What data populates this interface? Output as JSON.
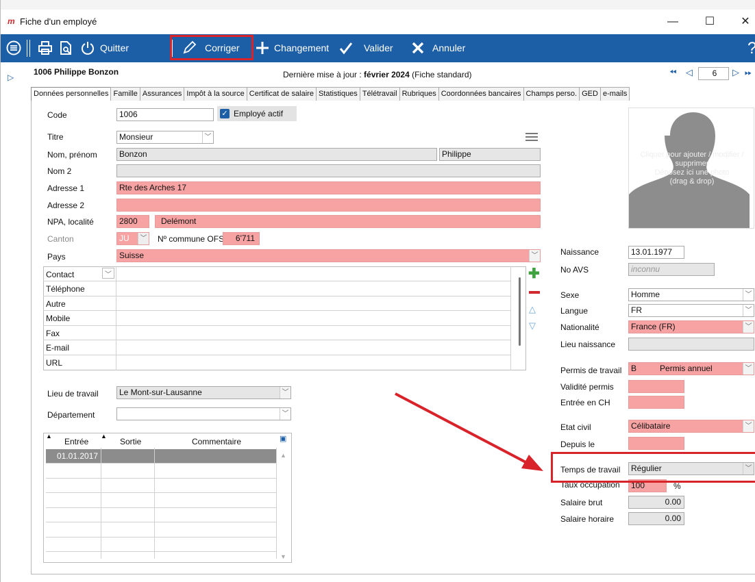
{
  "window": {
    "app_logo": "m",
    "title": "Fiche d'un employé",
    "min": "—",
    "max": "☐",
    "close": "✕"
  },
  "toolbar": {
    "quit": "Quitter",
    "correct": "Corriger",
    "change": "Changement",
    "validate": "Valider",
    "cancel": "Annuler"
  },
  "header": {
    "employee": "1006 Philippe Bonzon",
    "update_prefix": "Dernière mise à jour : ",
    "update_date": "février 2024",
    "update_suffix": " (Fiche standard)",
    "record_no": "6"
  },
  "tabs": [
    "Données personnelles",
    "Famille",
    "Assurances",
    "Impôt à la source",
    "Certificat de salaire",
    "Statistiques",
    "Télétravail",
    "Rubriques",
    "Coordonnées bancaires",
    "Champs perso.",
    "GED",
    "e-mails"
  ],
  "form": {
    "code_label": "Code",
    "code": "1006",
    "active_label": "Employé actif",
    "title_label": "Titre",
    "title": "Monsieur",
    "name_label": "Nom, prénom",
    "last_name": "Bonzon",
    "first_name": "Philippe",
    "name2_label": "Nom 2",
    "name2": "",
    "addr1_label": "Adresse 1",
    "addr1": "Rte des Arches 17",
    "addr2_label": "Adresse 2",
    "addr2": "",
    "npa_label": "NPA, localité",
    "npa": "2800",
    "city": "Delémont",
    "canton_label": "Canton",
    "canton": "JU",
    "ofs_label": "Nº commune OFS",
    "ofs": "6'711",
    "country_label": "Pays",
    "country": "Suisse"
  },
  "contacts": {
    "type": "Contact",
    "rows": [
      "Téléphone",
      "Autre",
      "Mobile",
      "Fax",
      "E-mail",
      "URL"
    ]
  },
  "work": {
    "place_label": "Lieu de travail",
    "place": "Le Mont-sur-Lausanne",
    "dept_label": "Département",
    "dept": ""
  },
  "history": {
    "headers": [
      "Entrée",
      "Sortie",
      "Commentaire"
    ],
    "rows": [
      [
        "01.01.2017",
        "",
        ""
      ]
    ]
  },
  "photo": {
    "text": "Cliquer pour ajouter / modifier / supprimer\nDéposez ici une photo\n(drag & drop)"
  },
  "right": {
    "birth_label": "Naissance",
    "birth": "13.01.1977",
    "avs_label": "No AVS",
    "avs": "inconnu",
    "sex_label": "Sexe",
    "sex": "Homme",
    "lang_label": "Langue",
    "lang": "FR",
    "nat_label": "Nationalité",
    "nat": "France (FR)",
    "birthplace_label": "Lieu naissance",
    "permit_label": "Permis de travail",
    "permit_code": "B",
    "permit_name": "Permis annuel",
    "validity_label": "Validité permis",
    "entry_label": "Entrée en CH",
    "civil_label": "Etat civil",
    "civil": "Célibataire",
    "since_label": "Depuis le",
    "worktime_label": "Temps de travail",
    "worktime": "Régulier",
    "rate_label": "Taux occupation",
    "rate": "100",
    "rate_unit": "%",
    "gross_label": "Salaire brut",
    "gross": "0.00",
    "hourly_label": "Salaire horaire",
    "hourly": "0.00"
  },
  "colors": {
    "toolbar": "#1d5fa6",
    "highlight": "#d8232a",
    "required": "#f8a3a3"
  }
}
